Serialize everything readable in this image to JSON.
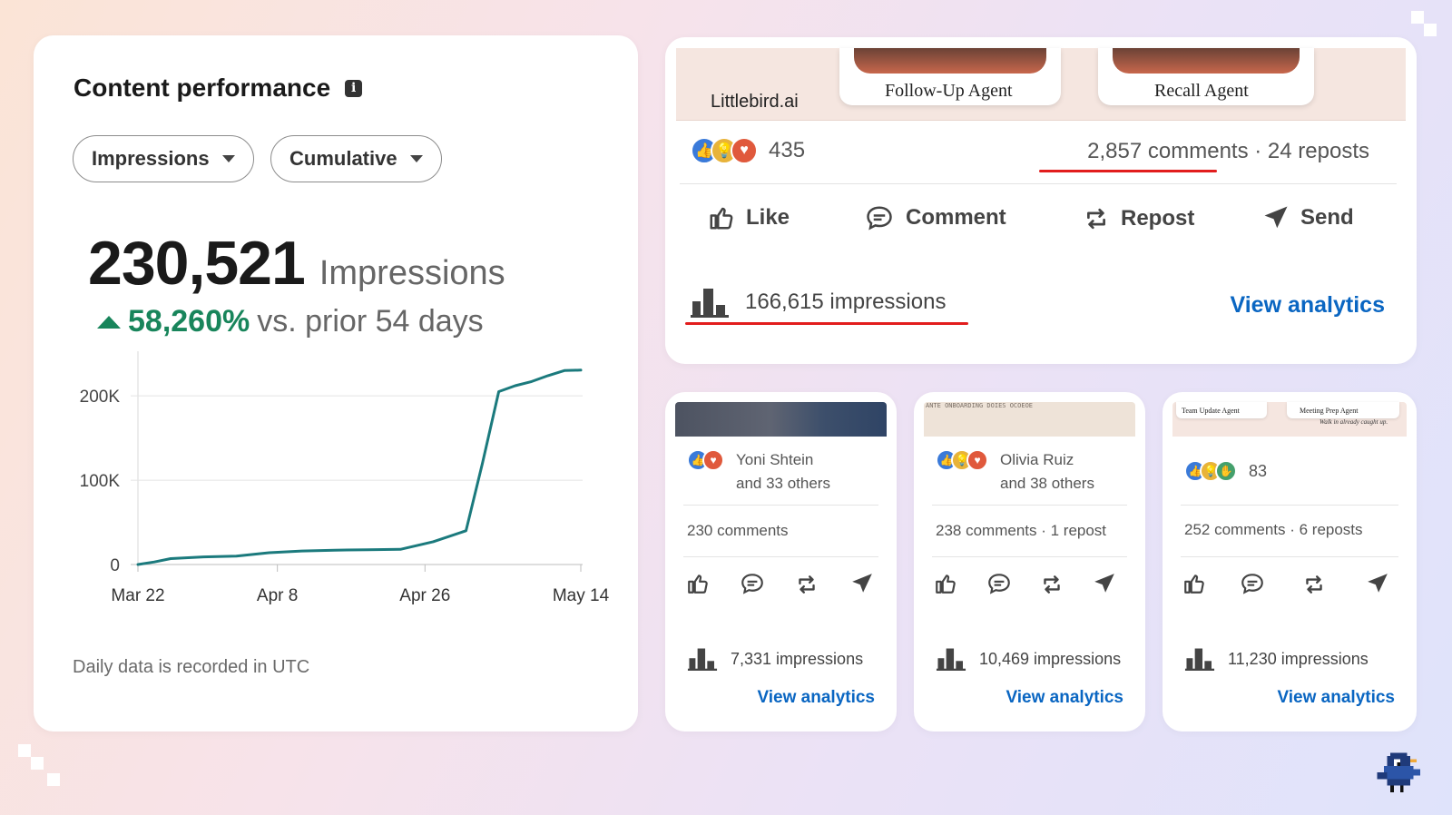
{
  "performance": {
    "title": "Content performance",
    "metric_dropdown": "Impressions",
    "mode_dropdown": "Cumulative",
    "total_value": "230,521",
    "total_unit": "Impressions",
    "delta_percent": "58,260%",
    "delta_text": "vs. prior 54 days",
    "footnote": "Daily data is recorded in UTC",
    "colors": {
      "line": "#1b7a7d",
      "positive": "#18855b"
    }
  },
  "chart_data": {
    "type": "line",
    "x_tick_labels": [
      "Mar 22",
      "Apr 8",
      "Apr 26",
      "May 14"
    ],
    "y_tick_labels": [
      "0",
      "100K",
      "200K"
    ],
    "ylim": [
      0,
      240000
    ],
    "grid": true,
    "series": [
      {
        "x": [
          0,
          2,
          4,
          8,
          12,
          16,
          20,
          24,
          28,
          32,
          36,
          40,
          42,
          44,
          46,
          48,
          50,
          52,
          54
        ],
        "values": [
          0,
          3000,
          7000,
          9000,
          10000,
          14000,
          16000,
          17000,
          17500,
          18000,
          27000,
          40000,
          120000,
          205000,
          212000,
          217000,
          224000,
          230000,
          230521
        ]
      }
    ]
  },
  "main_post": {
    "strip_brand": "Littlebird.ai",
    "strip_label_1": "Follow-Up Agent",
    "strip_label_2": "Recall Agent",
    "reaction_count": "435",
    "comments": "2,857 comments",
    "reposts": "24 reposts",
    "separator": "·",
    "actions": {
      "like": "Like",
      "comment": "Comment",
      "repost": "Repost",
      "send": "Send"
    },
    "impressions": "166,615 impressions",
    "view_analytics": "View analytics"
  },
  "small_posts": [
    {
      "reactor_name": "Yoni Shtein",
      "reactor_others": "and 33 others",
      "stats": "230 comments",
      "impressions": "7,331 impressions",
      "view_analytics": "View analytics"
    },
    {
      "strip_text": "ANTE ONBOARDING DOIES OCOEOE",
      "reactor_name": "Olivia Ruiz",
      "reactor_others": "and 38 others",
      "stats": "238 comments · 1 repost",
      "impressions": "10,469 impressions",
      "view_analytics": "View analytics"
    },
    {
      "strip_label_1": "Team Update Agent",
      "strip_label_2": "Meeting Prep Agent",
      "strip_tagline": "Walk in already caught up.",
      "reaction_count": "83",
      "stats": "252 comments · 6 reposts",
      "impressions": "11,230 impressions",
      "view_analytics": "View analytics"
    }
  ],
  "icons": {
    "info": "info-icon",
    "like": "thumbs-up-icon",
    "comment": "speech-bubble-icon",
    "repost": "repost-arrows-icon",
    "send": "paper-plane-icon",
    "analytics": "bar-chart-icon",
    "mascot": "pixel-bird-icon"
  },
  "colors": {
    "link": "#0a66c2",
    "highlight_underline": "#e21d1d"
  }
}
